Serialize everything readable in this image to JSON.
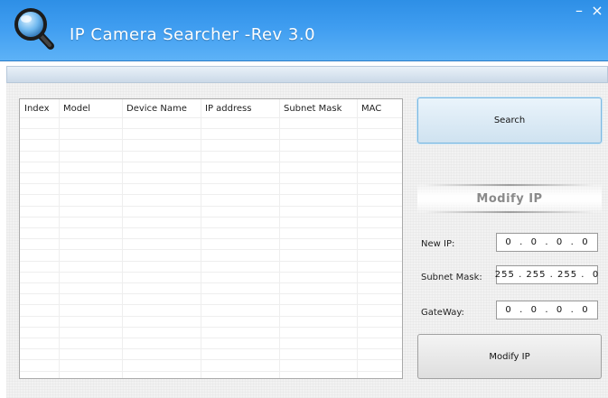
{
  "window": {
    "title": "IP Camera Searcher -Rev 3.0",
    "minimize_glyph": "–",
    "close_glyph": "×",
    "logo_icon": "magnifier-icon",
    "accent_color": "#3f9df0"
  },
  "table": {
    "columns": [
      "Index",
      "Model",
      "Device Name",
      "IP address",
      "Subnet Mask",
      "MAC"
    ],
    "rows": []
  },
  "buttons": {
    "search_label": "Search",
    "modify_label": "Modify IP"
  },
  "modify_section": {
    "title": "Modify IP",
    "fields": [
      {
        "label": "New IP:",
        "value": "0  .  0  .  0  .  0"
      },
      {
        "label": "Subnet Mask:",
        "value": "255 . 255 . 255 .  0"
      },
      {
        "label": "GateWay:",
        "value": "0  .  0  .  0  .  0"
      }
    ]
  }
}
